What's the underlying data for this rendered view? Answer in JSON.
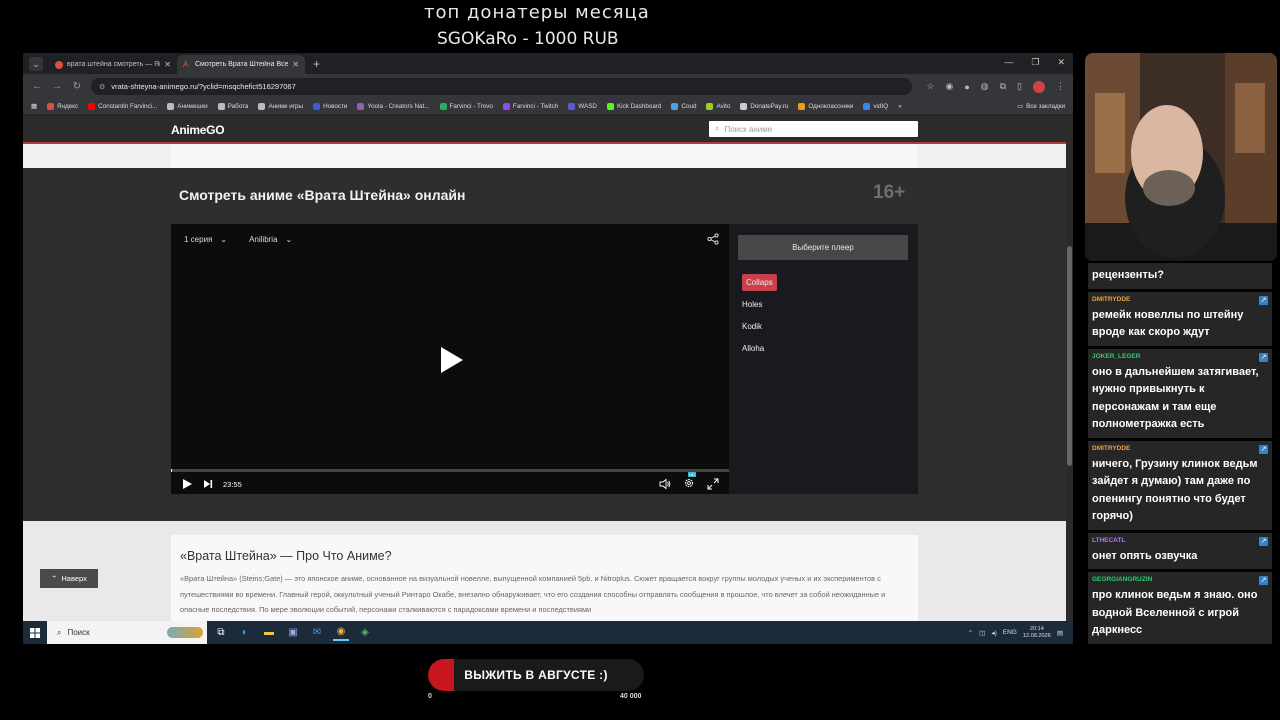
{
  "overlay": {
    "donors_title": "топ донатеры месяца",
    "top_donor": "SGOKaRo - 1000 RUB"
  },
  "browser": {
    "tabs": [
      {
        "label": "врата штейна смотреть — Янд",
        "active": false
      },
      {
        "label": "Смотреть Врата Штейна Все С",
        "active": true
      }
    ],
    "url": "vrata-shteyna-animego.ru/?yclid=msqchefict516297067",
    "bookmarks": [
      {
        "label": "Яндекс",
        "color": "#e14c3c"
      },
      {
        "label": "Constantin Farvinci...",
        "color": "#ff0000"
      },
      {
        "label": "Анимешки",
        "color": "#bbbbbb"
      },
      {
        "label": "Работа",
        "color": "#bbbbbb"
      },
      {
        "label": "Аниме игры",
        "color": "#bbbbbb"
      },
      {
        "label": "Новости",
        "color": "#3b5bdb"
      },
      {
        "label": "Yoola - Creators Nat...",
        "color": "#9b59b6"
      },
      {
        "label": "Farvinci - Trovo",
        "color": "#27ae60"
      },
      {
        "label": "Farvinci - Twitch",
        "color": "#9146ff"
      },
      {
        "label": "WASD",
        "color": "#5b5bd6"
      },
      {
        "label": "Kick Dashboard",
        "color": "#53fc18"
      },
      {
        "label": "Coud",
        "color": "#4aa3df"
      },
      {
        "label": "Avito",
        "color": "#97cf26"
      },
      {
        "label": "DonatePay.ru",
        "color": "#cccccc"
      },
      {
        "label": "Одноклассники",
        "color": "#f39c12"
      },
      {
        "label": "vidIQ",
        "color": "#3b82f6"
      }
    ],
    "bookmarks_all": "Все закладки"
  },
  "site": {
    "logo": "AnimeGO",
    "search_placeholder": "Поиск аниме",
    "watch_title": "Смотреть аниме «Врата Штейна» онлайн",
    "age_rating": "16+",
    "episode": "1 серия",
    "dub": "Anilibria",
    "time": "23:55",
    "choose_player": "Выберите плеер",
    "players": [
      {
        "label": "Collaps",
        "active": true
      },
      {
        "label": "Holes",
        "active": false
      },
      {
        "label": "Kodik",
        "active": false
      },
      {
        "label": "Alloha",
        "active": false
      }
    ],
    "about_title": "«Врата Штейна» — Про Что Аниме?",
    "about_text": "«Врата Штейна» (Steins;Gate) — это японское аниме, основанное на визуальной новелле, выпущенной компанией 5pb. и Nitroplus. Сюжет вращается вокруг группы молодых ученых и их экспериментов с путешествиями во времени. Главный герой, оккультный ученый Ринтаро Окабе, внезапно обнаруживает, что его создания способны отправлять сообщения в прошлое, что влечет за собой неожиданные и опасные последствия. По мере эволюции событий, персонажи сталкиваются с парадоксами времени и последствиями",
    "to_top": "Наверх"
  },
  "taskbar": {
    "search_label": "Поиск",
    "lang": "ENG",
    "time": "20:14",
    "date": "12.08.2026"
  },
  "chat": [
    {
      "user": "",
      "text": "рецензенты?",
      "color": "#ffffff"
    },
    {
      "user": "DMITRYDDE",
      "text": "ремейк новеллы по штейну вроде как скоро ждут",
      "color": "#e8a040"
    },
    {
      "user": "JOKER_LEGER",
      "text": "оно в дальнейшем затягивает, нужно привыкнуть к персонажам и там еще полнометражка есть",
      "color": "#2ecc71"
    },
    {
      "user": "DMITRYDDE",
      "text": "ничего, Грузину клинок ведьм зайдет я думаю) там даже по опенингу понятно что будет горячо)",
      "color": "#e8a040"
    },
    {
      "user": "LTHECATL",
      "text": "онет опять озвучка",
      "color": "#b07cff"
    },
    {
      "user": "GEORGIANGRUZIN",
      "text": "про клинок ведьм я знаю. оно водной Вселенной с игрой даркнесс",
      "color": "#2ecc71"
    }
  ],
  "goal": {
    "label": "ВЫЖИТЬ В АВГУСТЕ :)",
    "min": "0",
    "max": "40 000",
    "progress": 0.0
  }
}
